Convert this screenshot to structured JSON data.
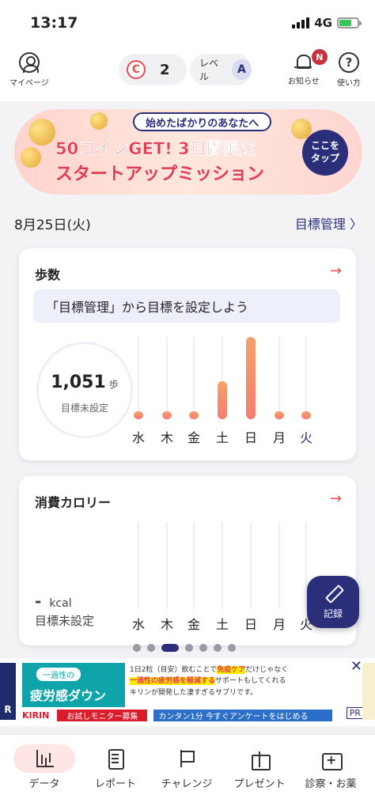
{
  "status": {
    "time": "13:17",
    "network": "4G"
  },
  "header": {
    "mypage_label": "マイページ",
    "coin_symbol": "C",
    "coin_count": "2",
    "level_label": "レベル",
    "level_value": "A",
    "notice_badge": "N",
    "notice_label": "お知らせ",
    "help_symbol": "?",
    "help_label": "使い方"
  },
  "banner": {
    "top_text": "始めたばかりのあなたへ",
    "line1": "50コインGET! 3日間限定",
    "line2": "スタートアップミッション",
    "tap_line1": "ここを",
    "tap_line2": "タップ"
  },
  "date_row": {
    "date": "8月25日(火)",
    "goal_link": "目標管理 〉"
  },
  "steps_card": {
    "title": "歩数",
    "arrow": "→",
    "goal_prompt": "「目標管理」から目標を設定しよう",
    "value": "1,051",
    "unit": "歩",
    "sub": "目標未設定"
  },
  "calorie_card": {
    "title": "消費カロリー",
    "arrow": "→",
    "value": "-",
    "unit": "kcal",
    "sub": "目標未設定"
  },
  "chart_data": {
    "type": "bar",
    "categories": [
      "水",
      "木",
      "金",
      "土",
      "日",
      "月",
      "火"
    ],
    "values": [
      30,
      60,
      130,
      650,
      1400,
      30,
      30
    ],
    "title": "",
    "xlabel": "",
    "ylabel": "",
    "ylim": [
      0,
      1400
    ]
  },
  "calorie_days": [
    "水",
    "木",
    "金",
    "土",
    "日",
    "月",
    "火"
  ],
  "fab_label": "記録",
  "ad": {
    "left_top": "一過性の",
    "left_main": "疲労感ダウン",
    "mid_line1_a": "1日2粒（目安）飲むことで",
    "mid_line1_hl": "免疫ケア",
    "mid_line1_b": "だけじゃなく",
    "mid_line2_hl": "一過性の疲労感を軽減する",
    "mid_line2_b": "サポートもしてくれる",
    "mid_line3": "キリンが開発した凄すぎるサプリです。",
    "brand": "KIRIN",
    "red_label": "お試しモニター募集",
    "blue_label": "カンタン1分 今すぐアンケートをはじめる",
    "pr": "PR",
    "close": "✕",
    "edge_left": "R"
  },
  "tabs": [
    {
      "label": "データ"
    },
    {
      "label": "レポート"
    },
    {
      "label": "チャレンジ"
    },
    {
      "label": "プレゼント"
    },
    {
      "label": "診察・お薬"
    }
  ],
  "colors": {
    "accent": "#2b2f7a",
    "bar": "#f47e70",
    "banner_red": "#e23d52"
  }
}
